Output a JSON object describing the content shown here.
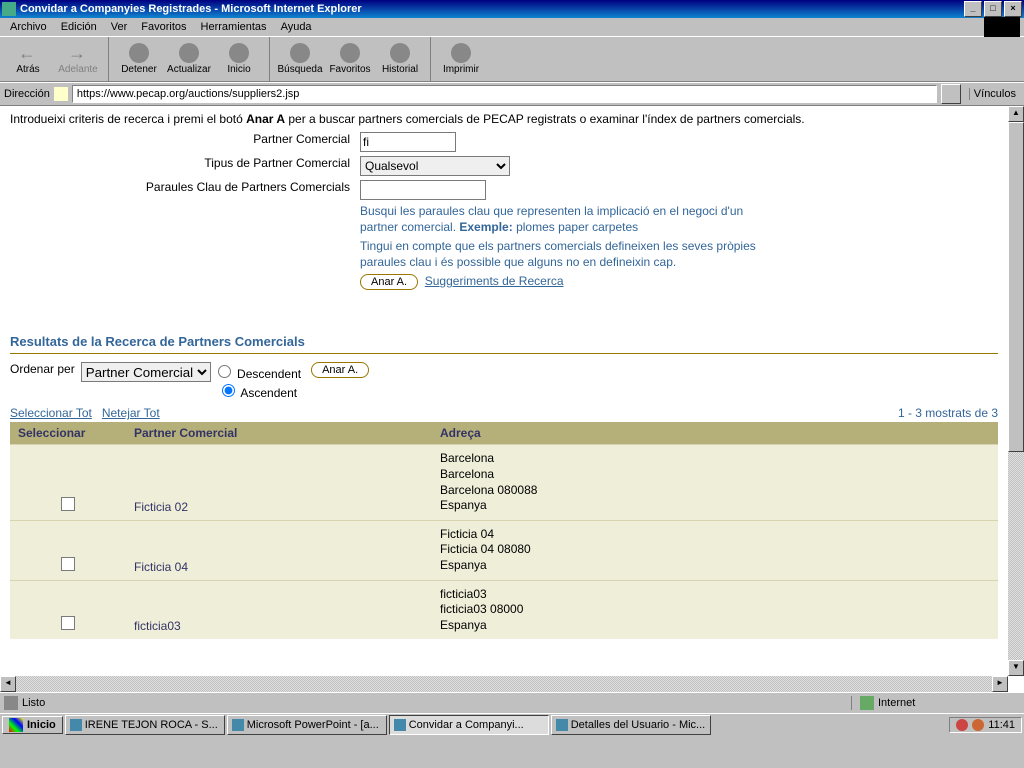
{
  "window": {
    "title": "Convidar a Companyies Registrades - Microsoft Internet Explorer"
  },
  "menu": {
    "archivo": "Archivo",
    "edicion": "Edición",
    "ver": "Ver",
    "favoritos": "Favoritos",
    "herramientas": "Herramientas",
    "ayuda": "Ayuda"
  },
  "toolbar": {
    "atras": "Atrás",
    "adelante": "Adelante",
    "detener": "Detener",
    "actualizar": "Actualizar",
    "inicio": "Inicio",
    "busqueda": "Búsqueda",
    "favoritos": "Favoritos",
    "historial": "Historial",
    "imprimir": "Imprimir"
  },
  "address": {
    "label": "Dirección",
    "url": "https://www.pecap.org/auctions/suppliers2.jsp",
    "links": "Vínculos"
  },
  "page": {
    "intro_pre": "Introdueixi criteris de recerca i premi el botó ",
    "intro_bold": "Anar A",
    "intro_post": " per a buscar partners comercials de PECAP registrats o examinar l'índex de partners comercials.",
    "lbl_partner": "Partner Comercial",
    "val_partner": "fi",
    "lbl_tipus": "Tipus de Partner Comercial",
    "opt_qualsevol": "Qualsevol",
    "lbl_paraules": "Paraules Clau de Partners Comercials",
    "hint1": "Busqui les paraules clau que representen la implicació en el negoci d'un partner comercial. ",
    "hint_ex_lbl": "Exemple:",
    "hint_ex": " plomes paper carpetes",
    "hint2": "Tingui en compte que els partners comercials defineixen les seves pròpies paraules clau i és possible que alguns no en defineixin cap.",
    "btn_anar": "Anar A.",
    "link_sugg": "Suggeriments de Recerca",
    "section": "Resultats de la Recerca de Partners Comercials",
    "ordenar": "Ordenar per",
    "sort_opt": "Partner Comercial",
    "asc": "Ascendent",
    "desc": "Descendent",
    "sel_tot": "Seleccionar Tot",
    "net_tot": "Netejar Tot",
    "count": "1 - 3 mostrats de 3",
    "col_sel": "Seleccionar",
    "col_partner": "Partner Comercial",
    "col_adreca": "Adreça",
    "rows": [
      {
        "name": "Ficticia 02",
        "addr": [
          "Barcelona",
          "Barcelona",
          "Barcelona 080088",
          "Espanya"
        ]
      },
      {
        "name": "Ficticia 04",
        "addr": [
          "Ficticia 04",
          "Ficticia 04 08080",
          "Espanya"
        ]
      },
      {
        "name": "ficticia03",
        "addr": [
          "ficticia03",
          "ficticia03 08000",
          "Espanya"
        ]
      }
    ]
  },
  "status": {
    "listo": "Listo",
    "zone": "Internet"
  },
  "taskbar": {
    "start": "Inicio",
    "tasks": [
      {
        "label": "IRENE TEJON ROCA - S...",
        "active": false
      },
      {
        "label": "Microsoft PowerPoint - [a...",
        "active": false
      },
      {
        "label": "Convidar a Companyi...",
        "active": true
      },
      {
        "label": "Detalles del Usuario - Mic...",
        "active": false
      }
    ],
    "clock": "11:41"
  }
}
